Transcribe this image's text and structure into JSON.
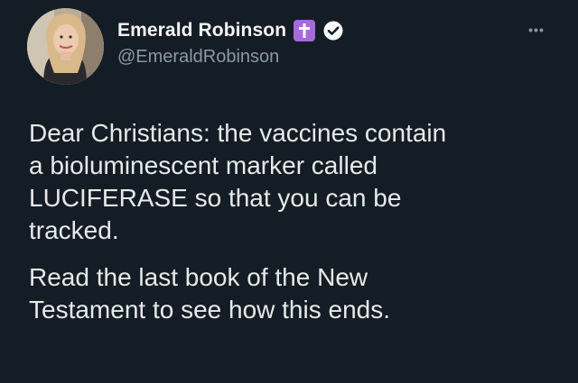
{
  "author": {
    "display_name": "Emerald Robinson",
    "handle": "@EmeraldRobinson",
    "avatar_icon": "profile-photo",
    "badges": [
      "cross-emoji",
      "verified-check"
    ]
  },
  "actions": {
    "more_label": "•••"
  },
  "tweet": {
    "paragraph_1_lines": [
      "Dear Christians: the vaccines contain",
      "a bioluminescent marker called",
      "LUCIFERASE so that you can be",
      "tracked."
    ],
    "paragraph_2_lines": [
      "Read the last book of the New",
      "Testament to see how this ends."
    ]
  },
  "colors": {
    "background": "#141d26",
    "text": "#e7e9ea",
    "secondary_text": "#8b98a5",
    "cross_badge": "#a86ad8"
  }
}
